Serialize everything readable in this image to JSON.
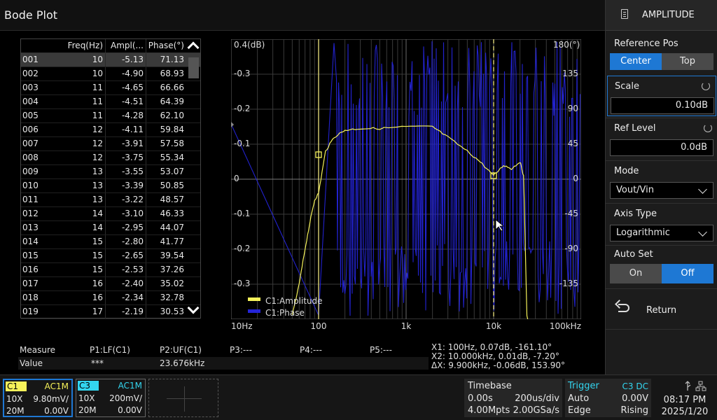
{
  "title": "Bode Plot",
  "panel": {
    "header": "AMPLITUDE",
    "header_icon": "document-icon",
    "reference_pos": {
      "label": "Reference Pos",
      "options": [
        "Center",
        "Top"
      ],
      "selected": "Center"
    },
    "scale": {
      "label": "Scale",
      "value": "0.10dB"
    },
    "ref_level": {
      "label": "Ref Level",
      "value": "0.0dB"
    },
    "mode": {
      "label": "Mode",
      "value": "Vout/Vin"
    },
    "axis_type": {
      "label": "Axis Type",
      "value": "Logarithmic"
    },
    "auto_set": {
      "label": "Auto Set",
      "options": [
        "On",
        "Off"
      ],
      "selected": "Off"
    },
    "return_label": "Return"
  },
  "table": {
    "headers": [
      "",
      "Freq(Hz)",
      "Ampl(...",
      "Phase(°)"
    ],
    "rows": [
      [
        "001",
        "10",
        "-5.13",
        "71.13"
      ],
      [
        "002",
        "10",
        "-4.90",
        "68.93"
      ],
      [
        "003",
        "11",
        "-4.65",
        "66.66"
      ],
      [
        "004",
        "11",
        "-4.51",
        "64.39"
      ],
      [
        "005",
        "11",
        "-4.28",
        "62.10"
      ],
      [
        "006",
        "12",
        "-4.11",
        "59.84"
      ],
      [
        "007",
        "12",
        "-3.91",
        "57.58"
      ],
      [
        "008",
        "12",
        "-3.75",
        "55.34"
      ],
      [
        "009",
        "13",
        "-3.55",
        "53.07"
      ],
      [
        "010",
        "13",
        "-3.39",
        "50.85"
      ],
      [
        "011",
        "13",
        "-3.22",
        "48.57"
      ],
      [
        "012",
        "14",
        "-3.10",
        "46.33"
      ],
      [
        "013",
        "14",
        "-2.95",
        "44.07"
      ],
      [
        "014",
        "15",
        "-2.80",
        "41.77"
      ],
      [
        "015",
        "15",
        "-2.65",
        "39.54"
      ],
      [
        "016",
        "15",
        "-2.53",
        "37.26"
      ],
      [
        "017",
        "16",
        "-2.40",
        "35.02"
      ],
      [
        "018",
        "16",
        "-2.34",
        "32.78"
      ],
      [
        "019",
        "17",
        "-2.19",
        "30.53"
      ]
    ],
    "selected_row": 0
  },
  "plot": {
    "left_top_label": "0.4(dB)",
    "right_top_label": "180(°)",
    "left_ticks": [
      "-0.3",
      "-0.2",
      "-0.1",
      "0",
      "-0.1",
      "-0.2",
      "-0.3"
    ],
    "right_ticks": [
      "135",
      "90",
      "45",
      "0",
      "-45",
      "-90",
      "-135"
    ],
    "x_ticks": [
      "10Hz",
      "100",
      "1k",
      "10k",
      "100kHz"
    ],
    "legend": [
      {
        "name": "C1:Amplitude",
        "color": "#f5f25a"
      },
      {
        "name": "C1:Phase",
        "color": "#2424d8"
      }
    ]
  },
  "chart_data": {
    "type": "line",
    "xlabel": "",
    "ylabel": "",
    "x_scale": "log",
    "xlim": [
      10,
      100000
    ],
    "ylim": [
      -0.4,
      0.4
    ],
    "y2lim": [
      -180,
      180
    ],
    "grid": true,
    "legend_position": "bottom-left",
    "series": [
      {
        "name": "C1:Amplitude",
        "axis": "left",
        "x": [
          50,
          60,
          70,
          80,
          90,
          100,
          120,
          150,
          200,
          300,
          500,
          1000,
          2000,
          3000,
          5000,
          7000,
          10000,
          13000,
          16000,
          20000,
          22000,
          24000
        ],
        "y": [
          -0.39,
          -0.3,
          -0.2,
          -0.12,
          -0.06,
          -0.04,
          0.08,
          0.12,
          0.14,
          0.145,
          0.145,
          0.15,
          0.15,
          0.12,
          0.08,
          0.05,
          0.01,
          0.04,
          0.03,
          0.05,
          0.01,
          -0.39
        ]
      },
      {
        "name": "C1:Phase",
        "axis": "right",
        "x": [
          10,
          30,
          100,
          200,
          300,
          500,
          1000,
          3000,
          10000,
          30000,
          100000
        ],
        "y": [
          71,
          20,
          -160,
          150,
          -120,
          120,
          -170,
          160,
          -161,
          140,
          0
        ]
      }
    ],
    "cursors": {
      "x1": 100,
      "x2": 10000
    }
  },
  "measure": {
    "labels": [
      "Measure",
      "P1:LF(C1)",
      "P2:UF(C1)",
      "P3:---",
      "P4:---",
      "P5:---"
    ],
    "value_label": "Value",
    "values": [
      "***",
      "23.676kHz"
    ],
    "cursor_readout": [
      "X1: 100Hz, 0.07dB, -161.10°",
      "X2: 10.000kHz, 0.01dB, -7.20°",
      "ΔX: 9.900kHz, -0.06dB, 153.90°"
    ]
  },
  "channels": [
    {
      "name": "C1",
      "coupling": "AC1M",
      "probe": "10X",
      "scale": "9.80mV/",
      "bw": "20M",
      "offset": "0.00V",
      "color": "#f5f25a"
    },
    {
      "name": "C3",
      "coupling": "AC1M",
      "probe": "10X",
      "scale": "200mV/",
      "bw": "20M",
      "offset": "0.00V",
      "color": "#33d6f0"
    }
  ],
  "timebase": {
    "label": "Timebase",
    "delay": "0.00s",
    "scale": "200us/div",
    "memory": "4.00Mpts",
    "rate": "2.00GSa/s"
  },
  "trigger": {
    "label": "Trigger",
    "source": "C3 DC",
    "mode": "Auto",
    "level": "0.00V",
    "type": "Edge",
    "slope": "Rising"
  },
  "clock": {
    "time": "08:17 PM",
    "date": "2025/1/20"
  }
}
